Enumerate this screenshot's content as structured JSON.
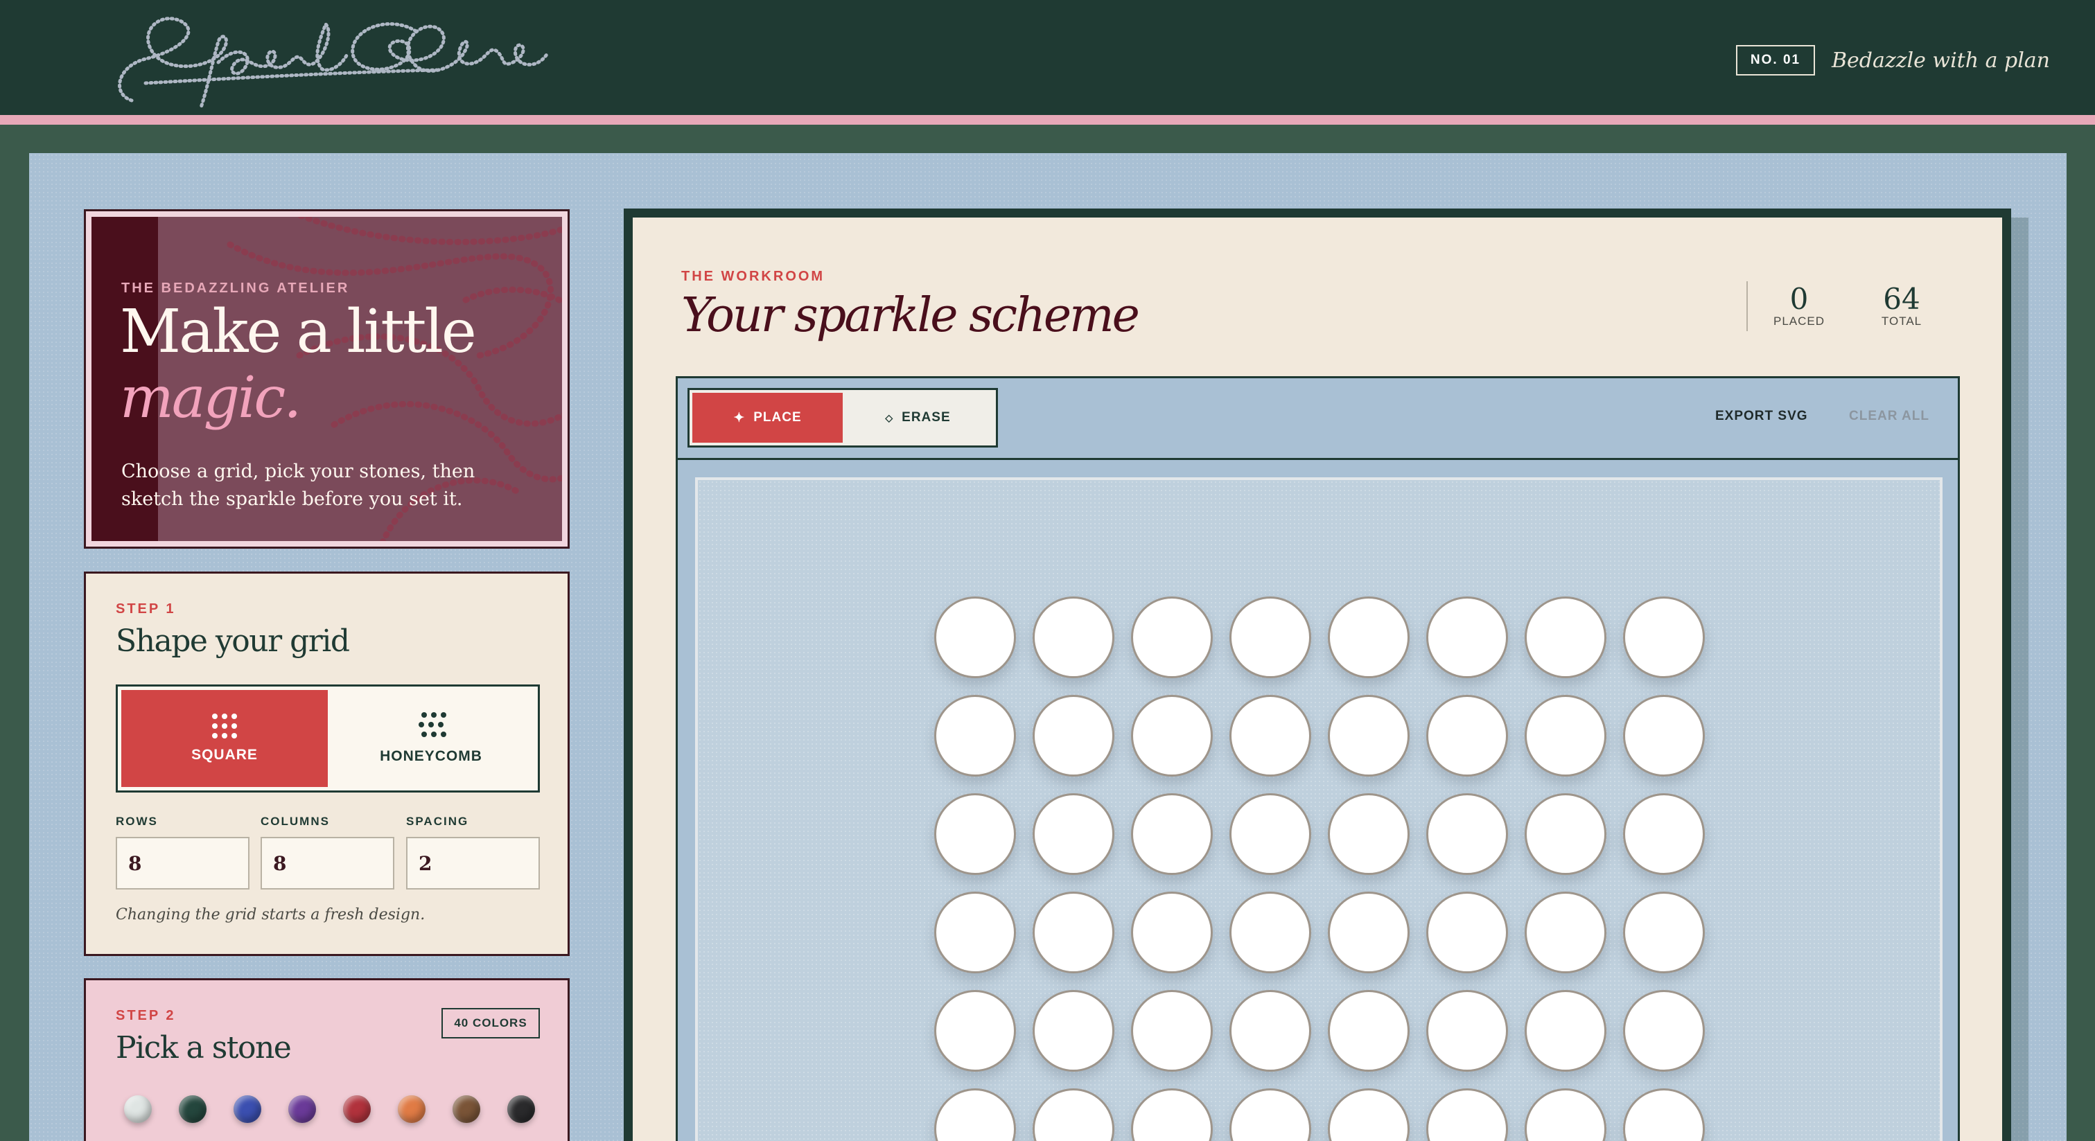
{
  "header": {
    "logo_text": "Sparkle Scheme",
    "issue_badge": "NO. 01",
    "tagline": "Bedazzle with a plan"
  },
  "hero": {
    "eyebrow": "THE BEDAZZLING ATELIER",
    "title_line1": "Make a little",
    "title_line2": "magic.",
    "description": "Choose a grid, pick your stones, then sketch the sparkle before you set it."
  },
  "step1": {
    "eyebrow": "STEP 1",
    "title": "Shape your grid",
    "shapes": [
      {
        "label": "SQUARE",
        "icon": "square-grid-icon",
        "selected": true
      },
      {
        "label": "HONEYCOMB",
        "icon": "honeycomb-grid-icon",
        "selected": false
      }
    ],
    "fields": [
      {
        "label": "ROWS",
        "value": "8"
      },
      {
        "label": "COLUMNS",
        "value": "8"
      },
      {
        "label": "SPACING",
        "value": "2"
      }
    ],
    "note": "Changing the grid starts a fresh design."
  },
  "step2": {
    "eyebrow": "STEP 2",
    "title": "Pick a stone",
    "badge": "40 COLORS",
    "stones": [
      {
        "name": "crystal",
        "color": "#dfe5e3"
      },
      {
        "name": "emerald",
        "color": "#24463d"
      },
      {
        "name": "sapphire",
        "color": "#3b4fb0"
      },
      {
        "name": "amethyst",
        "color": "#6a3a98"
      },
      {
        "name": "ruby",
        "color": "#b1323c"
      },
      {
        "name": "topaz",
        "color": "#e07b45"
      },
      {
        "name": "bronze",
        "color": "#7a5437"
      },
      {
        "name": "jet",
        "color": "#2a2a2c"
      }
    ]
  },
  "workroom": {
    "eyebrow": "THE WORKROOM",
    "title": "Your sparkle scheme",
    "placed_count": "0",
    "placed_label": "PLACED",
    "total_count": "64",
    "total_label": "TOTAL",
    "modes": [
      {
        "label": "PLACE",
        "icon": "sparkle-icon",
        "selected": true
      },
      {
        "label": "ERASE",
        "icon": "diamond-outline-icon",
        "selected": false
      }
    ],
    "export_label": "EXPORT SVG",
    "clear_label": "CLEAR ALL",
    "grid": {
      "rows": 8,
      "columns": 8
    }
  },
  "colors": {
    "header_bg": "#1f3a33",
    "accent_pink": "#e7a8b8",
    "accent_red": "#d14545",
    "board_blue": "#a9c0d4",
    "cream": "#f2e9dc",
    "wine": "#4a0f1c"
  }
}
